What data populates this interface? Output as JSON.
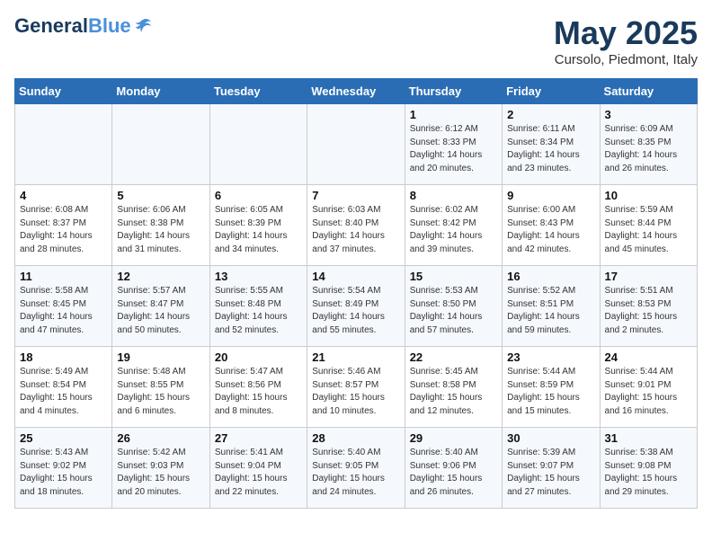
{
  "header": {
    "logo_general": "General",
    "logo_blue": "Blue",
    "month": "May 2025",
    "location": "Cursolo, Piedmont, Italy"
  },
  "weekdays": [
    "Sunday",
    "Monday",
    "Tuesday",
    "Wednesday",
    "Thursday",
    "Friday",
    "Saturday"
  ],
  "weeks": [
    [
      {
        "day": "",
        "sunrise": "",
        "sunset": "",
        "daylight": ""
      },
      {
        "day": "",
        "sunrise": "",
        "sunset": "",
        "daylight": ""
      },
      {
        "day": "",
        "sunrise": "",
        "sunset": "",
        "daylight": ""
      },
      {
        "day": "",
        "sunrise": "",
        "sunset": "",
        "daylight": ""
      },
      {
        "day": "1",
        "sunrise": "Sunrise: 6:12 AM",
        "sunset": "Sunset: 8:33 PM",
        "daylight": "Daylight: 14 hours and 20 minutes."
      },
      {
        "day": "2",
        "sunrise": "Sunrise: 6:11 AM",
        "sunset": "Sunset: 8:34 PM",
        "daylight": "Daylight: 14 hours and 23 minutes."
      },
      {
        "day": "3",
        "sunrise": "Sunrise: 6:09 AM",
        "sunset": "Sunset: 8:35 PM",
        "daylight": "Daylight: 14 hours and 26 minutes."
      }
    ],
    [
      {
        "day": "4",
        "sunrise": "Sunrise: 6:08 AM",
        "sunset": "Sunset: 8:37 PM",
        "daylight": "Daylight: 14 hours and 28 minutes."
      },
      {
        "day": "5",
        "sunrise": "Sunrise: 6:06 AM",
        "sunset": "Sunset: 8:38 PM",
        "daylight": "Daylight: 14 hours and 31 minutes."
      },
      {
        "day": "6",
        "sunrise": "Sunrise: 6:05 AM",
        "sunset": "Sunset: 8:39 PM",
        "daylight": "Daylight: 14 hours and 34 minutes."
      },
      {
        "day": "7",
        "sunrise": "Sunrise: 6:03 AM",
        "sunset": "Sunset: 8:40 PM",
        "daylight": "Daylight: 14 hours and 37 minutes."
      },
      {
        "day": "8",
        "sunrise": "Sunrise: 6:02 AM",
        "sunset": "Sunset: 8:42 PM",
        "daylight": "Daylight: 14 hours and 39 minutes."
      },
      {
        "day": "9",
        "sunrise": "Sunrise: 6:00 AM",
        "sunset": "Sunset: 8:43 PM",
        "daylight": "Daylight: 14 hours and 42 minutes."
      },
      {
        "day": "10",
        "sunrise": "Sunrise: 5:59 AM",
        "sunset": "Sunset: 8:44 PM",
        "daylight": "Daylight: 14 hours and 45 minutes."
      }
    ],
    [
      {
        "day": "11",
        "sunrise": "Sunrise: 5:58 AM",
        "sunset": "Sunset: 8:45 PM",
        "daylight": "Daylight: 14 hours and 47 minutes."
      },
      {
        "day": "12",
        "sunrise": "Sunrise: 5:57 AM",
        "sunset": "Sunset: 8:47 PM",
        "daylight": "Daylight: 14 hours and 50 minutes."
      },
      {
        "day": "13",
        "sunrise": "Sunrise: 5:55 AM",
        "sunset": "Sunset: 8:48 PM",
        "daylight": "Daylight: 14 hours and 52 minutes."
      },
      {
        "day": "14",
        "sunrise": "Sunrise: 5:54 AM",
        "sunset": "Sunset: 8:49 PM",
        "daylight": "Daylight: 14 hours and 55 minutes."
      },
      {
        "day": "15",
        "sunrise": "Sunrise: 5:53 AM",
        "sunset": "Sunset: 8:50 PM",
        "daylight": "Daylight: 14 hours and 57 minutes."
      },
      {
        "day": "16",
        "sunrise": "Sunrise: 5:52 AM",
        "sunset": "Sunset: 8:51 PM",
        "daylight": "Daylight: 14 hours and 59 minutes."
      },
      {
        "day": "17",
        "sunrise": "Sunrise: 5:51 AM",
        "sunset": "Sunset: 8:53 PM",
        "daylight": "Daylight: 15 hours and 2 minutes."
      }
    ],
    [
      {
        "day": "18",
        "sunrise": "Sunrise: 5:49 AM",
        "sunset": "Sunset: 8:54 PM",
        "daylight": "Daylight: 15 hours and 4 minutes."
      },
      {
        "day": "19",
        "sunrise": "Sunrise: 5:48 AM",
        "sunset": "Sunset: 8:55 PM",
        "daylight": "Daylight: 15 hours and 6 minutes."
      },
      {
        "day": "20",
        "sunrise": "Sunrise: 5:47 AM",
        "sunset": "Sunset: 8:56 PM",
        "daylight": "Daylight: 15 hours and 8 minutes."
      },
      {
        "day": "21",
        "sunrise": "Sunrise: 5:46 AM",
        "sunset": "Sunset: 8:57 PM",
        "daylight": "Daylight: 15 hours and 10 minutes."
      },
      {
        "day": "22",
        "sunrise": "Sunrise: 5:45 AM",
        "sunset": "Sunset: 8:58 PM",
        "daylight": "Daylight: 15 hours and 12 minutes."
      },
      {
        "day": "23",
        "sunrise": "Sunrise: 5:44 AM",
        "sunset": "Sunset: 8:59 PM",
        "daylight": "Daylight: 15 hours and 15 minutes."
      },
      {
        "day": "24",
        "sunrise": "Sunrise: 5:44 AM",
        "sunset": "Sunset: 9:01 PM",
        "daylight": "Daylight: 15 hours and 16 minutes."
      }
    ],
    [
      {
        "day": "25",
        "sunrise": "Sunrise: 5:43 AM",
        "sunset": "Sunset: 9:02 PM",
        "daylight": "Daylight: 15 hours and 18 minutes."
      },
      {
        "day": "26",
        "sunrise": "Sunrise: 5:42 AM",
        "sunset": "Sunset: 9:03 PM",
        "daylight": "Daylight: 15 hours and 20 minutes."
      },
      {
        "day": "27",
        "sunrise": "Sunrise: 5:41 AM",
        "sunset": "Sunset: 9:04 PM",
        "daylight": "Daylight: 15 hours and 22 minutes."
      },
      {
        "day": "28",
        "sunrise": "Sunrise: 5:40 AM",
        "sunset": "Sunset: 9:05 PM",
        "daylight": "Daylight: 15 hours and 24 minutes."
      },
      {
        "day": "29",
        "sunrise": "Sunrise: 5:40 AM",
        "sunset": "Sunset: 9:06 PM",
        "daylight": "Daylight: 15 hours and 26 minutes."
      },
      {
        "day": "30",
        "sunrise": "Sunrise: 5:39 AM",
        "sunset": "Sunset: 9:07 PM",
        "daylight": "Daylight: 15 hours and 27 minutes."
      },
      {
        "day": "31",
        "sunrise": "Sunrise: 5:38 AM",
        "sunset": "Sunset: 9:08 PM",
        "daylight": "Daylight: 15 hours and 29 minutes."
      }
    ]
  ]
}
